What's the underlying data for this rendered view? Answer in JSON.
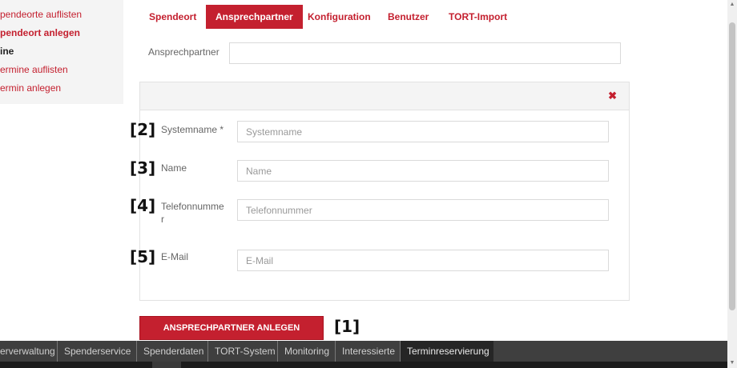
{
  "sidebar": {
    "items": [
      {
        "label": "pendeorte auflisten",
        "style": "link"
      },
      {
        "label": "pendeort anlegen",
        "style": "active"
      },
      {
        "label": "ine",
        "style": "head"
      },
      {
        "label": "ermine auflisten",
        "style": "link"
      },
      {
        "label": "ermin anlegen",
        "style": "link"
      }
    ]
  },
  "tabs": [
    {
      "label": "Spendeort",
      "active": false
    },
    {
      "label": "Ansprechpartner",
      "active": true
    },
    {
      "label": "Konfiguration",
      "active": false
    },
    {
      "label": "Benutzer",
      "active": false
    },
    {
      "label": "TORT-Import",
      "active": false
    }
  ],
  "contact_select": {
    "label": "Ansprechpartner",
    "value": ""
  },
  "panel": {
    "close_icon": "close-icon",
    "fields": [
      {
        "marker": "[2]",
        "label": "Systemname *",
        "placeholder": "Systemname"
      },
      {
        "marker": "[3]",
        "label": "Name",
        "placeholder": "Name"
      },
      {
        "marker": "[4]",
        "label": "Telefonnumme\nr",
        "placeholder": "Telefonnummer"
      },
      {
        "marker": "[5]",
        "label": "E-Mail",
        "placeholder": "E-Mail"
      }
    ]
  },
  "create_button": {
    "label": "ANSPRECHPARTNER ANLEGEN",
    "marker": "[1]"
  },
  "bottom_nav": [
    {
      "label": "erverwaltung",
      "active": false
    },
    {
      "label": "Spenderservice",
      "active": false
    },
    {
      "label": "Spenderdaten",
      "active": false
    },
    {
      "label": "TORT-System",
      "active": false
    },
    {
      "label": "Monitoring",
      "active": false
    },
    {
      "label": "Interessierte",
      "active": false
    },
    {
      "label": "Terminreservierung",
      "active": true
    }
  ],
  "colors": {
    "accent": "#c4202f",
    "bottom_bar": "#3f3f3f"
  }
}
